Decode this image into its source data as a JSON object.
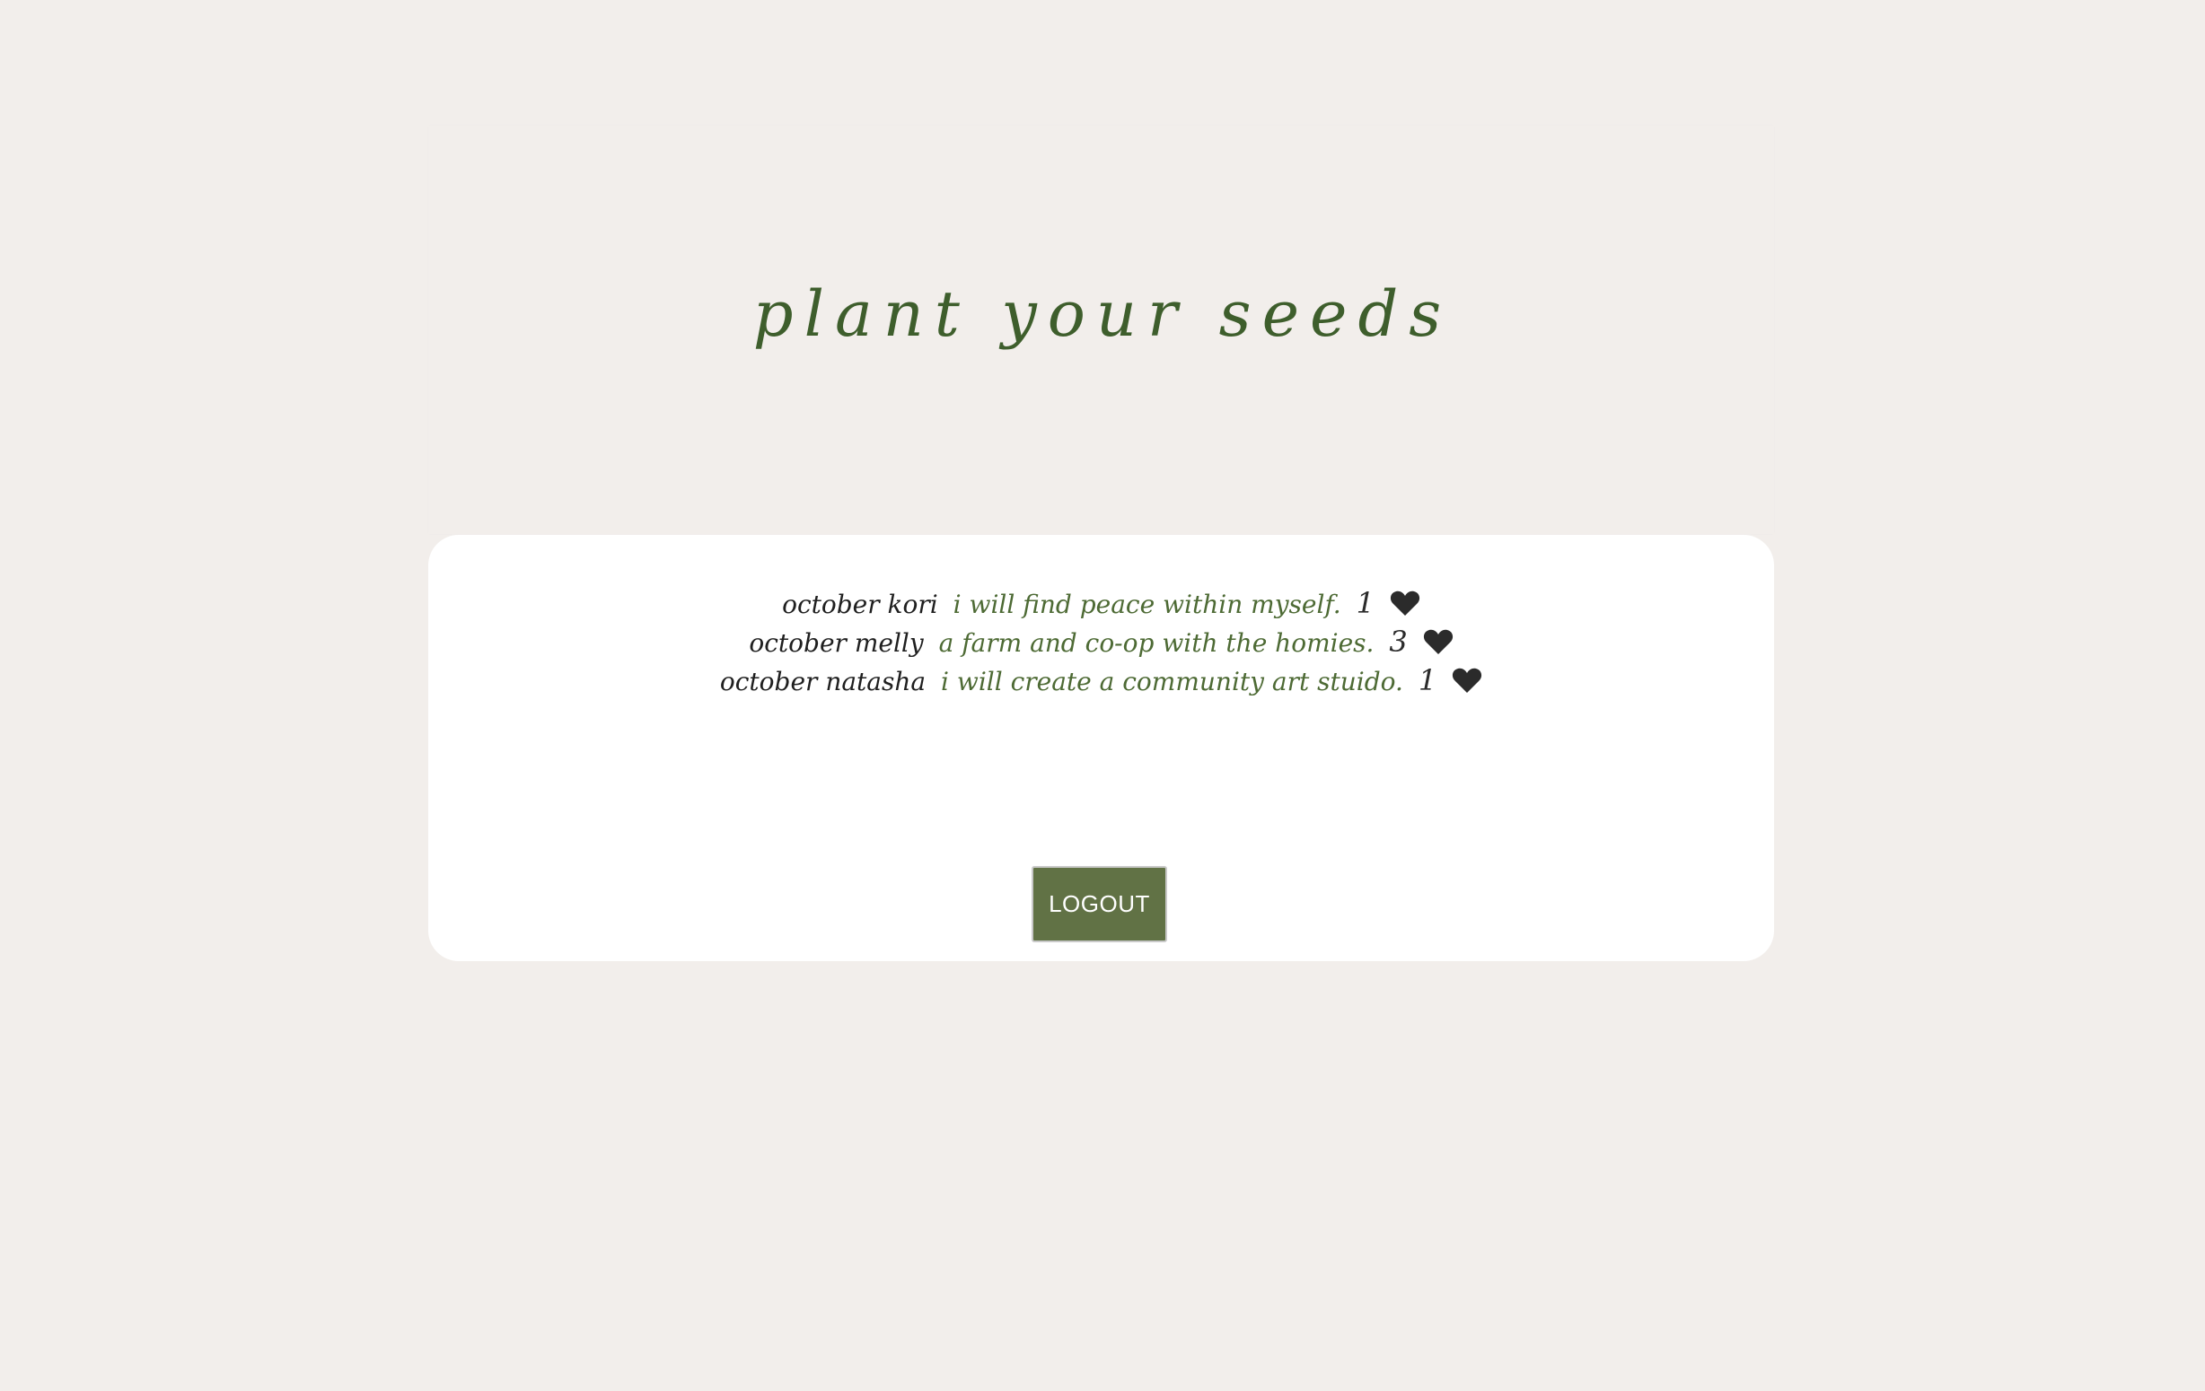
{
  "header": {
    "title": "plant your seeds"
  },
  "seeds": [
    {
      "month": "october",
      "name": "kori",
      "text": "i will find peace within myself.",
      "likes": "1",
      "icon": "heart-icon"
    },
    {
      "month": "october",
      "name": "melly",
      "text": "a farm and co-op with the homies.",
      "likes": "3",
      "icon": "heart-icon"
    },
    {
      "month": "october",
      "name": "natasha",
      "text": "i will create a community art stuido.",
      "likes": "1",
      "icon": "heart-icon"
    }
  ],
  "actions": {
    "logout_label": "LOGOUT"
  },
  "colors": {
    "background": "#f2eeeb",
    "card": "#ffffff",
    "title_green": "#3e5e2c",
    "seed_text_green": "#4d6a34",
    "button_green": "#617245",
    "heart": "#2b2b2b"
  }
}
